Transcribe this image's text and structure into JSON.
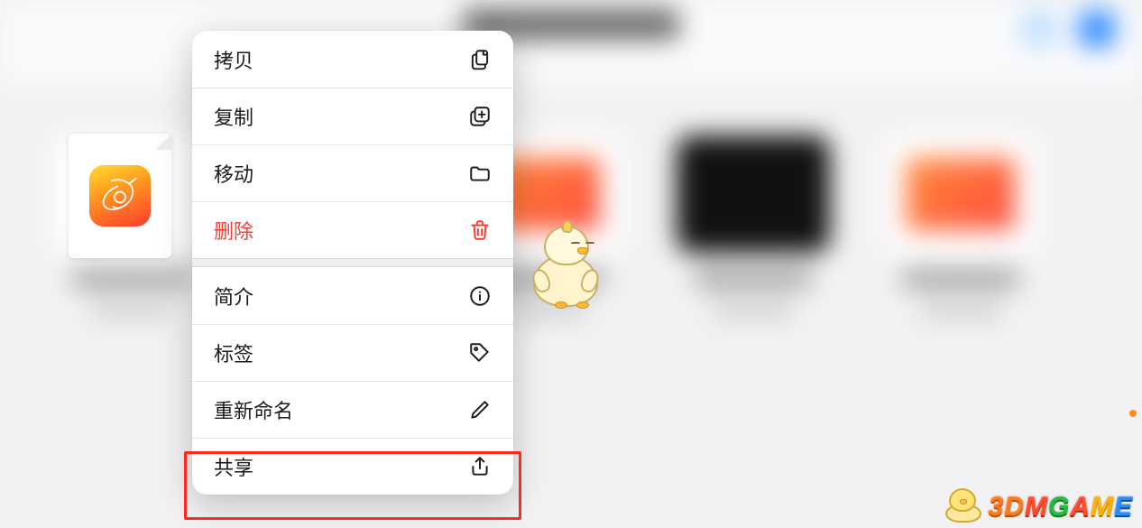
{
  "file": {
    "app_icon": "garageband-icon"
  },
  "menu": {
    "items": [
      {
        "id": "copy",
        "label": "拷贝",
        "icon": "doc-on-doc-icon",
        "danger": false
      },
      {
        "id": "duplicate",
        "label": "复制",
        "icon": "plus-square-icon",
        "danger": false
      },
      {
        "id": "move",
        "label": "移动",
        "icon": "folder-icon",
        "danger": false
      },
      {
        "id": "delete",
        "label": "删除",
        "icon": "trash-icon",
        "danger": true
      }
    ],
    "items2": [
      {
        "id": "info",
        "label": "简介",
        "icon": "info-circle-icon",
        "danger": false
      },
      {
        "id": "tags",
        "label": "标签",
        "icon": "tag-icon",
        "danger": false
      },
      {
        "id": "rename",
        "label": "重新命名",
        "icon": "pencil-icon",
        "danger": false
      },
      {
        "id": "share",
        "label": "共享",
        "icon": "share-icon",
        "danger": false
      }
    ],
    "highlighted": "share"
  },
  "watermark": {
    "text": "3DMGAME",
    "icon": "chick-icon"
  }
}
